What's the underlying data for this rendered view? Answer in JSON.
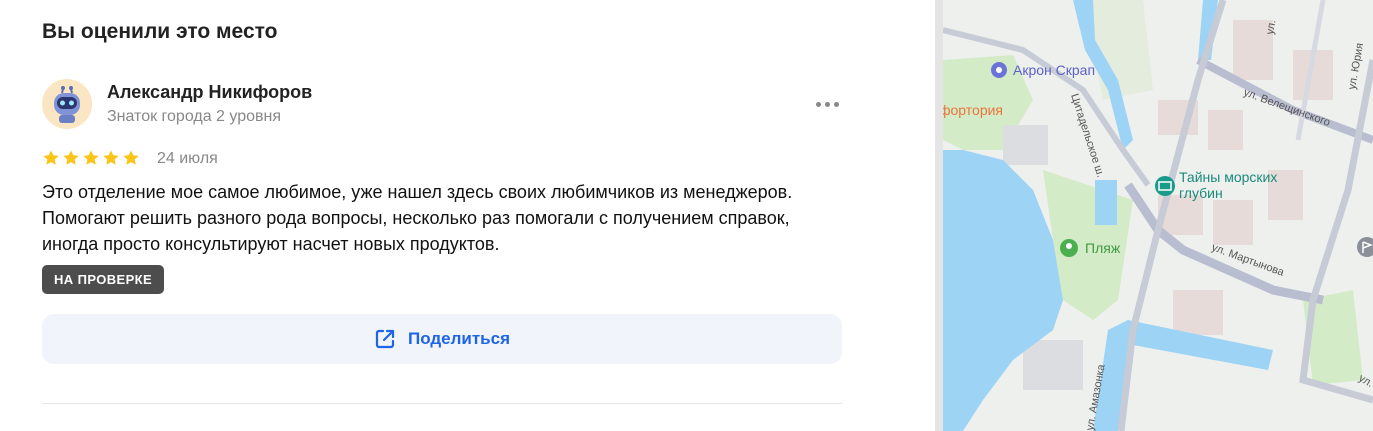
{
  "section": {
    "title": "Вы оценили это место"
  },
  "review": {
    "author": {
      "name": "Александр Никифоров",
      "level": "Знаток города 2 уровня",
      "avatar_icon": "robot-avatar-icon"
    },
    "rating": 5,
    "rating_max": 5,
    "date": "24 июля",
    "text": "Это отделение мое самое любимое, уже нашел здесь своих любимчиков из менеджеров. Помогают решить разного рода вопросы, несколько раз помогали с получением справок, иногда просто консультируют насчет новых продуктов.",
    "status": "НА ПРОВЕРКЕ",
    "more_icon": "more-dots-icon"
  },
  "share": {
    "label": "Поделиться",
    "icon": "share-icon"
  },
  "map": {
    "labels": {
      "akron": "Акрон Скрап",
      "fortoria": "фортория",
      "citadel": "Цитадельское ш.",
      "veleshchinskogo": "ул. Велещинского",
      "tainy_line1": "Тайны морских",
      "tainy_line2": "глубин",
      "plyazh": "Пляж",
      "martynova": "ул. Мартынова",
      "amazonka": "ул. Амазонка",
      "ul_top": "ул.",
      "ul_yuri": "ул. Юрия",
      "ul_right": "ул."
    }
  },
  "colors": {
    "accent": "#1e64e6",
    "star": "#fcc419",
    "badge_bg": "#4d4d4d",
    "water": "#9dd3f5",
    "museum_teal": "#1a9a8a",
    "poi_purple": "#6b73d9",
    "fortoria_orange": "#e8743b"
  }
}
